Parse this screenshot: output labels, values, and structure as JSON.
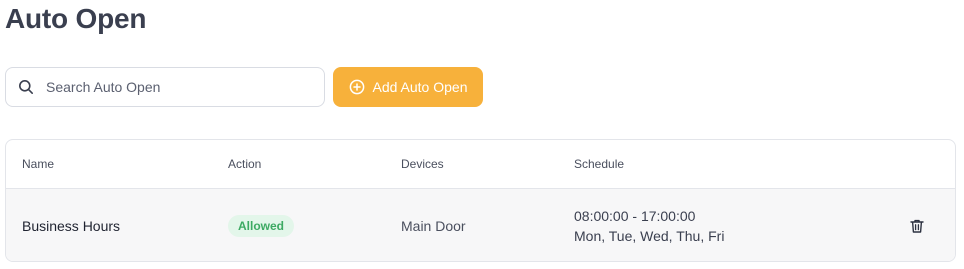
{
  "header": {
    "title": "Auto Open"
  },
  "toolbar": {
    "search_placeholder": "Search Auto Open",
    "search_value": "",
    "add_label": "Add Auto Open",
    "add_color": "#f7b13b"
  },
  "table": {
    "columns": [
      "Name",
      "Action",
      "Devices",
      "Schedule"
    ],
    "rows": [
      {
        "name": "Business Hours",
        "action": "Allowed",
        "devices": "Main Door",
        "schedule_time": "08:00:00 - 17:00:00",
        "schedule_days": "Mon, Tue, Wed, Thu, Fri",
        "delete_icon": "trash-icon"
      }
    ]
  },
  "icons": {
    "search": "search-icon",
    "add": "plus-circle-icon",
    "delete": "trash-icon"
  },
  "colors": {
    "allowed_badge_bg": "#e3f6ea",
    "allowed_badge_text": "#3daa63"
  }
}
